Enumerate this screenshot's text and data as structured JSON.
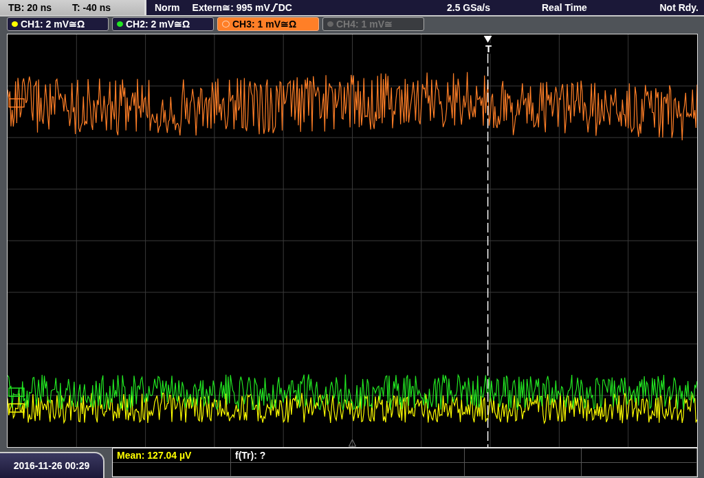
{
  "status_bar": {
    "timebase": "TB: 20 ns",
    "trigger_time": "T: -40 ns",
    "mode": "Norm",
    "trigger_source": "Extern≅: 995 mV",
    "coupling": "DC",
    "sample_rate": "2.5 GSa/s",
    "acquisition": "Real Time",
    "state": "Not Rdy."
  },
  "channels": [
    {
      "label": "CH1: 2 mV≅Ω",
      "color": "#ffff00",
      "selected": false,
      "enabled": true
    },
    {
      "label": "CH2: 2 mV≅Ω",
      "color": "#22e622",
      "selected": false,
      "enabled": true
    },
    {
      "label": "CH3: 1 mV≅Ω",
      "color": "#ff7f27",
      "selected": true,
      "enabled": true
    },
    {
      "label": "CH4: 1 mV≅",
      "selected": false,
      "enabled": false
    }
  ],
  "trigger": {
    "label": "T"
  },
  "measurements": [
    {
      "text": "Mean: 127.04 µV",
      "color": "#ffff00"
    },
    {
      "text": "f(Tr): ?",
      "color": "#ffffff"
    }
  ],
  "date": "2016-11-26 00:29"
}
